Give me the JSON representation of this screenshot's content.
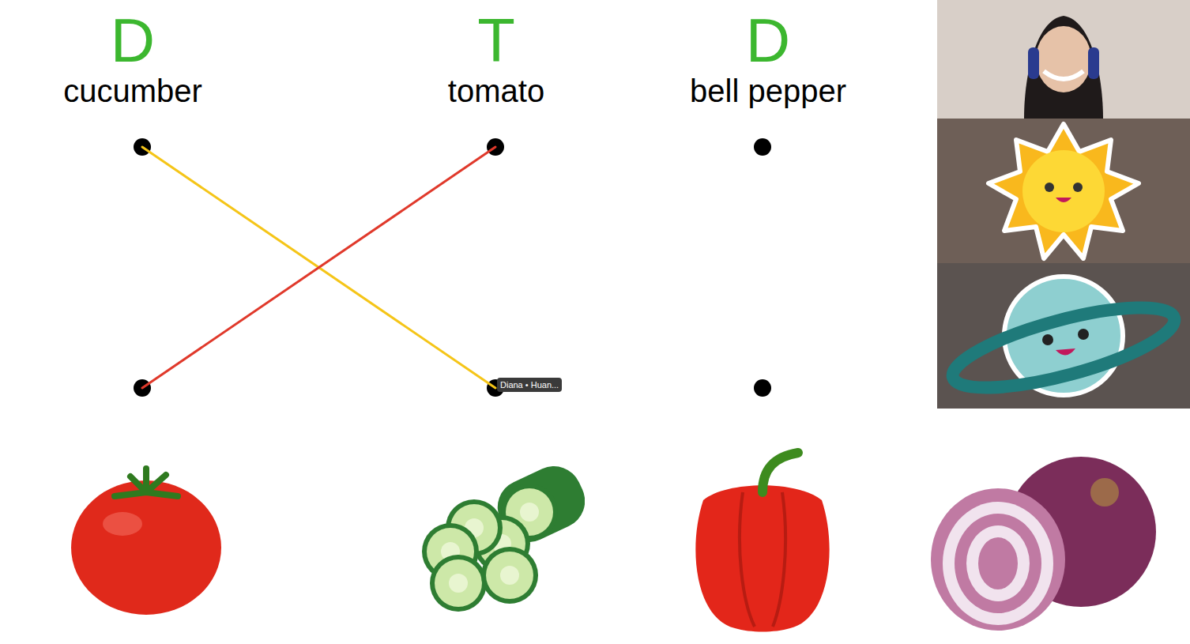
{
  "words": [
    {
      "label": "cucumber",
      "mark": "D"
    },
    {
      "label": "tomato",
      "mark": "T"
    },
    {
      "label": "bell pepper",
      "mark": "D"
    }
  ],
  "pictures": [
    {
      "kind": "tomato"
    },
    {
      "kind": "cucumber"
    },
    {
      "kind": "pepper"
    },
    {
      "kind": "onion"
    }
  ],
  "matches": [
    {
      "from": 0,
      "to": 1,
      "color": "#f5c518"
    },
    {
      "from": 1,
      "to": 0,
      "color": "#e0392b"
    }
  ],
  "annotation_label": "Diana • Huan...",
  "participants": [
    {
      "kind": "video"
    },
    {
      "kind": "sun"
    },
    {
      "kind": "planet"
    }
  ]
}
